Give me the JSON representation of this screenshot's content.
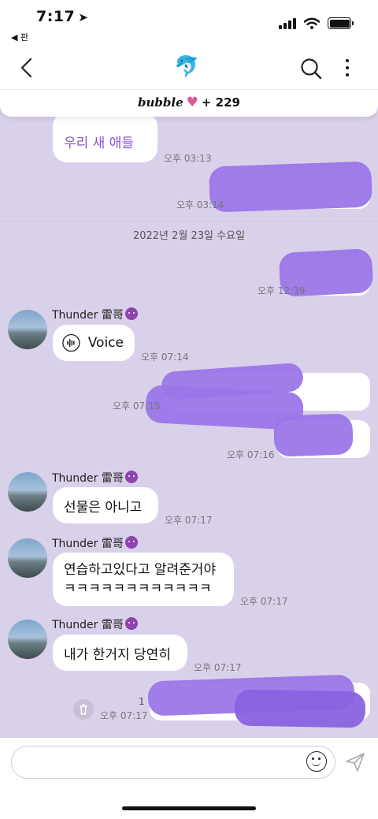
{
  "status_bar": {
    "time": "7:17",
    "location_glyph": "➤",
    "back_app_label": "◀ 판"
  },
  "nav": {
    "title_icon": "🐬",
    "icons": [
      "back-chevron-icon",
      "search-icon",
      "more-vertical-icon"
    ]
  },
  "banner": {
    "word": "bubble",
    "heart": "♥",
    "count": "+ 229"
  },
  "chat": {
    "messages": {
      "m1_text": "우리 새 애들",
      "m1_time": "오후 03:13",
      "m2_time": "오후 03:14",
      "date_divider": "2022년 2월 23일 수요일",
      "m3_time": "오후 12:39",
      "sender": "Thunder 雷哥",
      "voice_label": "Voice",
      "m4_time": "오후 07:14",
      "m5_time": "오후 07:15",
      "m6_time": "오후 07:16",
      "m7_text": "선물은 아니고",
      "m7_time": "오후 07:17",
      "m8_line1": "연습하고있다고 알려준거야",
      "m8_line2": "ㅋㅋㅋㅋㅋㅋㅋㅋㅋㅋㅋㅋ",
      "m8_time": "오후 07:17",
      "m9_text": "내가 한거지 당연히",
      "m9_time": "오후 07:17",
      "m10_count": "1",
      "m10_time": "오후 07:17"
    }
  },
  "input": {
    "placeholder": ""
  },
  "colors": {
    "chat_background": "#d9d0ea",
    "accent_purple": "#9b76e8",
    "heart_pink": "#e05896",
    "link_text_purple": "#8a55d6"
  }
}
